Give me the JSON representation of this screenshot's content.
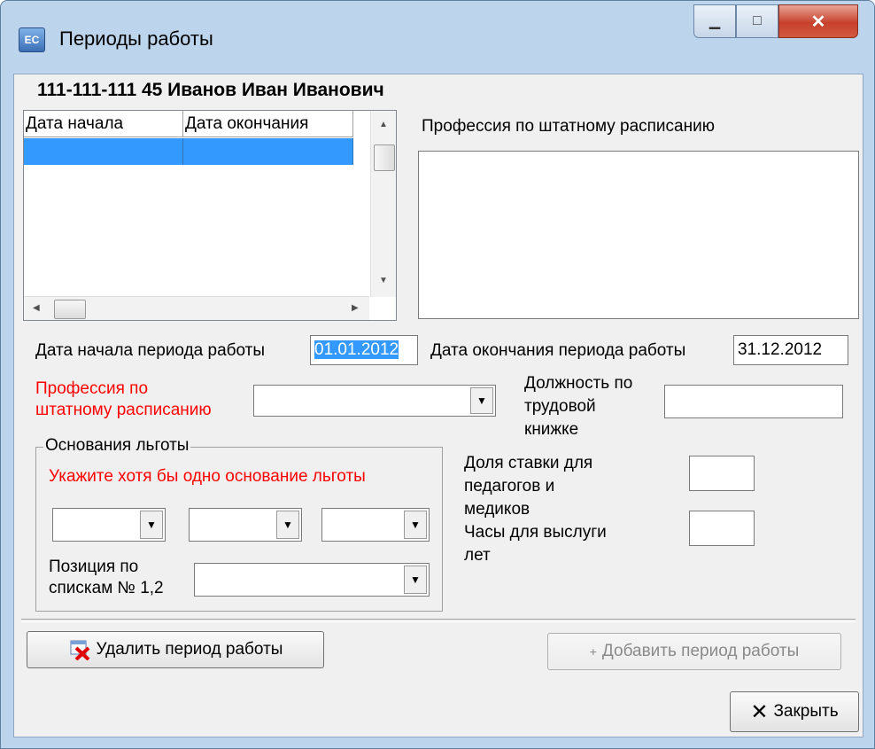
{
  "window": {
    "title": "Периоды работы",
    "app_icon_text": "ЕС",
    "minimize_glyph": "▁",
    "maximize_glyph": "□",
    "close_glyph": "✕"
  },
  "person": {
    "header": "111-111-111 45 Иванов Иван Иванович"
  },
  "periods_grid": {
    "columns": [
      "Дата начала",
      "Дата окончания"
    ],
    "selected_row": [
      "",
      ""
    ],
    "scroll_up": "▲",
    "scroll_down": "▼",
    "scroll_left": "◀",
    "scroll_right": "▶"
  },
  "profession_list": {
    "label": "Профессия по штатному расписанию"
  },
  "form": {
    "start_label": "Дата начала периода работы",
    "start_value": "01.01.2012",
    "end_label": "Дата окончания периода работы",
    "end_value": "31.12.2012",
    "profession_label_1": "Профессия по",
    "profession_label_2": "штатному расписанию",
    "profession_value": "",
    "position_label_1": "Должность по",
    "position_label_2": "трудовой",
    "position_label_3": "книжке",
    "position_value": "",
    "share_label_1": "Доля ставки для",
    "share_label_2": "педагогов и",
    "share_label_3": "медиков",
    "share_value": "",
    "hours_label_1": "Часы для выслуги",
    "hours_label_2": "лет",
    "hours_value": "",
    "dropdown_glyph": "▼"
  },
  "benefits": {
    "title": "Основания льготы",
    "warning": "Укажите хотя бы одно основание льготы",
    "basis_values": [
      "",
      "",
      ""
    ],
    "list_position_label_1": "Позиция по",
    "list_position_label_2": "спискам № 1,2",
    "list_position_value": ""
  },
  "buttons": {
    "delete": "Удалить период работы",
    "add": "Добавить период работы",
    "add_prefix": "+",
    "close": "Закрыть",
    "close_glyph": "✕"
  },
  "icons": {
    "delete_icon": "doc-with-red-x-icon"
  },
  "colors": {
    "selection": "#3399ff",
    "required_label": "#ff0000"
  }
}
